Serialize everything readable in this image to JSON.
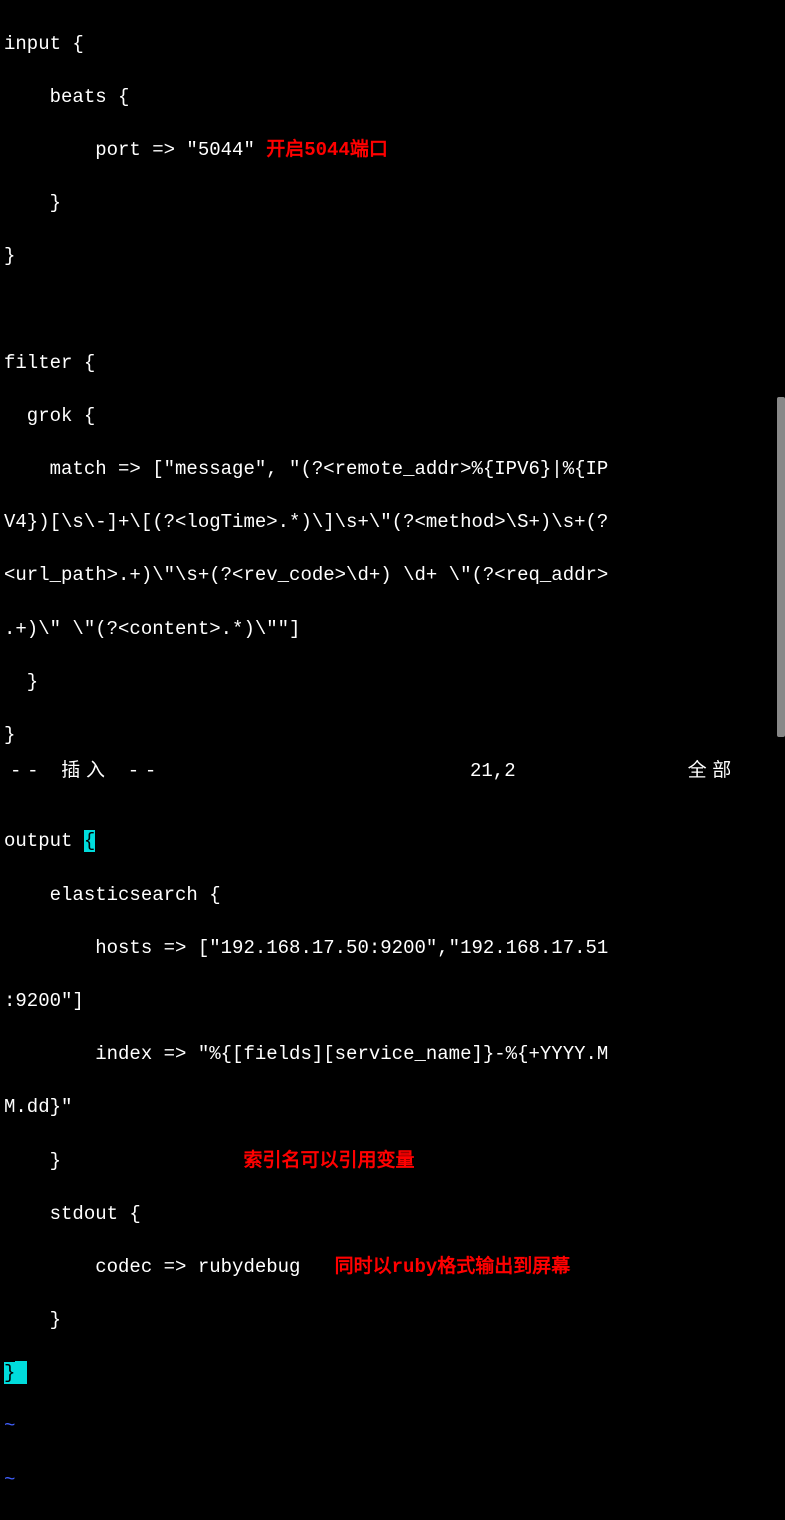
{
  "code": {
    "l1": "input {",
    "l2": "    beats {",
    "l3_pre": "        port => \"5044\" ",
    "l3_ann": "开启5044端口",
    "l4": "    }",
    "l5": "}",
    "l6": "",
    "l7": "filter {",
    "l8": "  grok {",
    "l9": "    match => [\"message\", \"(?<remote_addr>%{IPV6}|%{IP",
    "l10": "V4})[\\s\\-]+\\[(?<logTime>.*)\\]\\s+\\\"(?<method>\\S+)\\s+(?",
    "l11": "<url_path>.+)\\\"\\s+(?<rev_code>\\d+) \\d+ \\\"(?<req_addr>",
    "l12": ".+)\\\" \\\"(?<content>.*)\\\"\"]",
    "l13": "  }",
    "l14": "}",
    "l15": "",
    "l16_pre": "output ",
    "l16_br": "{",
    "l17": "    elasticsearch {",
    "l18": "        hosts => [\"192.168.17.50:9200\",\"192.168.17.51",
    "l19": ":9200\"]",
    "l20": "        index => \"%{[fields][service_name]}-%{+YYYY.M",
    "l21": "M.dd}\"",
    "l22_pre": "    }                ",
    "l22_ann": "索引名可以引用变量",
    "l23": "    stdout {",
    "l24_pre": "        codec => rubydebug   ",
    "l24_ann": "同时以ruby格式输出到屏幕",
    "l25": "    }",
    "l26_br": "}",
    "l27": "~",
    "l28": "~"
  },
  "status": {
    "mode": "-- 插入 --",
    "position": "21,2",
    "percent": "全部"
  }
}
